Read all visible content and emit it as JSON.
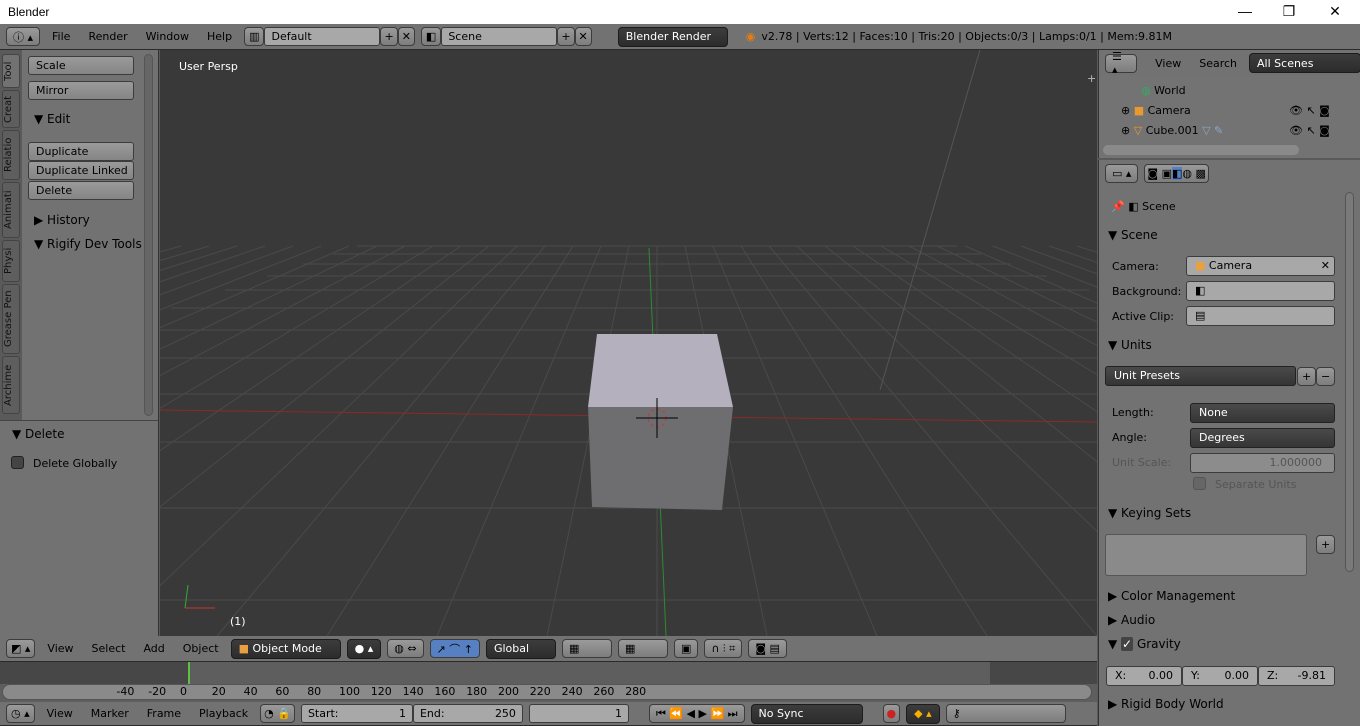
{
  "window": {
    "title": "Blender",
    "minimize": "—",
    "maximize": "❐",
    "close": "✕"
  },
  "info_header": {
    "menus": [
      "File",
      "Render",
      "Window",
      "Help"
    ],
    "screen_layout": "Default",
    "scene": "Scene",
    "engine": "Blender Render",
    "stats": "v2.78 | Verts:12 | Faces:10 | Tris:20 | Objects:0/3 | Lamps:0/1 | Mem:9.81M"
  },
  "toolshelf": {
    "tabs": [
      "Tool",
      "Creat",
      "Relatio",
      "Animati",
      "Physi",
      "Grease Pen",
      "Archime"
    ],
    "buttons_top": [
      "Scale",
      "Mirror"
    ],
    "edit_section": "Edit",
    "edit_buttons": [
      "Duplicate",
      "Duplicate Linked",
      "Delete"
    ],
    "history_section": "History",
    "rigify_section": "Rigify Dev Tools",
    "operator_panel": {
      "title": "Delete",
      "checkbox_label": "Delete Globally",
      "checked": false
    }
  },
  "viewport": {
    "view_label": "User Persp",
    "frame_label": "(1)",
    "axis_x": "x",
    "axis_y": "y"
  },
  "view3d_header": {
    "menus": [
      "View",
      "Select",
      "Add",
      "Object"
    ],
    "mode": "Object Mode",
    "orientation": "Global"
  },
  "timeline": {
    "ticks": [
      "-40",
      "-20",
      "0",
      "20",
      "40",
      "60",
      "80",
      "100",
      "120",
      "140",
      "160",
      "180",
      "200",
      "220",
      "240",
      "260",
      "280"
    ],
    "current_frame": 1
  },
  "timeline_header": {
    "menus": [
      "View",
      "Marker",
      "Frame",
      "Playback"
    ],
    "start_label": "Start:",
    "start": "1",
    "end_label": "End:",
    "end": "250",
    "current": "1",
    "sync": "No Sync"
  },
  "outliner": {
    "menus": [
      "View",
      "Search"
    ],
    "filter": "All Scenes",
    "items": [
      {
        "name": "World"
      },
      {
        "name": "Camera"
      },
      {
        "name": "Cube.001"
      }
    ]
  },
  "properties": {
    "breadcrumb": "Scene",
    "scene_section": {
      "title": "Scene",
      "camera_label": "Camera:",
      "camera_value": "Camera",
      "background_label": "Background:",
      "active_clip_label": "Active Clip:"
    },
    "units_section": {
      "title": "Units",
      "presets": "Unit Presets",
      "length_label": "Length:",
      "length_value": "None",
      "angle_label": "Angle:",
      "angle_value": "Degrees",
      "unit_scale_label": "Unit Scale:",
      "unit_scale_value": "1.000000",
      "separate_units": "Separate Units"
    },
    "keying_sets": "Keying Sets",
    "color_management": "Color Management",
    "audio": "Audio",
    "gravity": {
      "title": "Gravity",
      "checked": true,
      "x_label": "X:",
      "x": "0.00",
      "y_label": "Y:",
      "y": "0.00",
      "z_label": "Z:",
      "z": "-9.81"
    },
    "rigid_body_world": "Rigid Body World"
  }
}
